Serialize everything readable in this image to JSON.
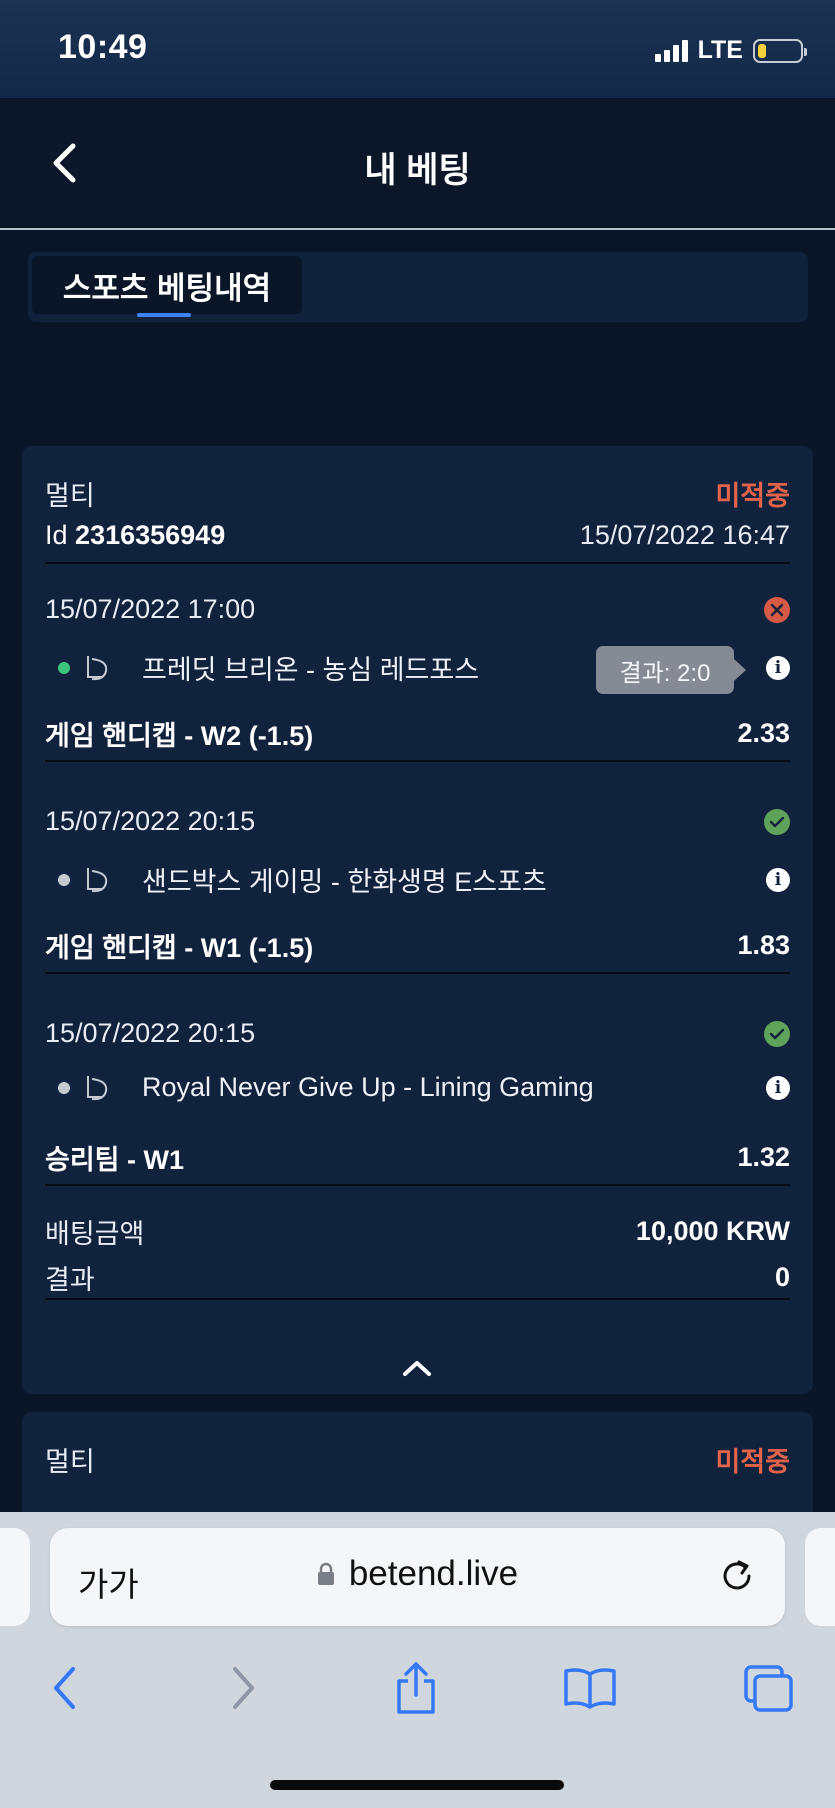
{
  "status_bar": {
    "time": "10:49",
    "network": "LTE",
    "battery_level": 0.2
  },
  "header": {
    "title": "내 베팅"
  },
  "tabs": [
    {
      "label": "스포츠 베팅내역",
      "active": true
    }
  ],
  "bet": {
    "type": "멀티",
    "status": "미적중",
    "id_label": "Id",
    "id_value": "2316356949",
    "placed_at": "15/07/2022 16:47",
    "selections": [
      {
        "date": "15/07/2022 17:00",
        "result_icon": "lost-x-icon",
        "match": "프레딧 브리온 - 농심 레드포스",
        "tooltip": "결과: 2:0",
        "market": "게임 핸디캡 - W2 (-1.5)",
        "odds": "2.33",
        "dot_color": "#3cc47c"
      },
      {
        "date": "15/07/2022 20:15",
        "result_icon": "won-check-icon",
        "match": "샌드박스 게이밍 - 한화생명 E스포츠",
        "market": "게임 핸디캡 - W1 (-1.5)",
        "odds": "1.83",
        "dot_color": "#c5cad3"
      },
      {
        "date": "15/07/2022 20:15",
        "result_icon": "won-check-icon",
        "match": "Royal Never Give Up - Lining Gaming",
        "market": "승리팀 - W1",
        "odds": "1.32",
        "dot_color": "#c5cad3"
      }
    ],
    "stake_label": "배팅금액",
    "stake_value": "10,000 KRW",
    "result_label": "결과",
    "result_value": "0"
  },
  "next_bet": {
    "type": "멀티",
    "status": "미적중"
  },
  "browser": {
    "text_size": "가가",
    "url": "betend.live"
  },
  "colors": {
    "background": "#0a1628",
    "card": "#11223d",
    "pending": "#e2634b",
    "won": "#5fa35a",
    "lost": "#d65a45",
    "accent": "#3b82f6"
  }
}
